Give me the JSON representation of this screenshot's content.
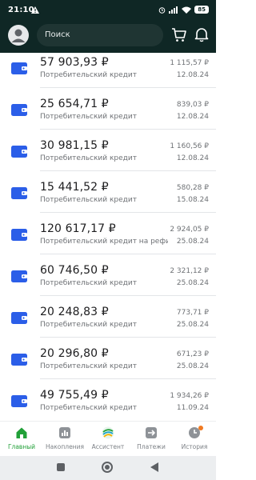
{
  "status_bar": {
    "time": "21:10",
    "battery": "85"
  },
  "header": {
    "search_placeholder": "Поиск"
  },
  "loans": [
    {
      "amount": "57 903,93 ₽",
      "description": "Потребительский кредит",
      "payment": "1 115,57 ₽",
      "date": "12.08.24"
    },
    {
      "amount": "25 654,71 ₽",
      "description": "Потребительский кредит",
      "payment": "839,03 ₽",
      "date": "12.08.24"
    },
    {
      "amount": "30 981,15 ₽",
      "description": "Потребительский кредит",
      "payment": "1 160,56 ₽",
      "date": "12.08.24"
    },
    {
      "amount": "15 441,52 ₽",
      "description": "Потребительский кредит",
      "payment": "580,28 ₽",
      "date": "15.08.24"
    },
    {
      "amount": "120 617,17 ₽",
      "description": "Потребительский кредит на рефи…",
      "payment": "2 924,05 ₽",
      "date": "25.08.24"
    },
    {
      "amount": "60 746,50 ₽",
      "description": "Потребительский кредит",
      "payment": "2 321,12 ₽",
      "date": "25.08.24"
    },
    {
      "amount": "20 248,83 ₽",
      "description": "Потребительский кредит",
      "payment": "773,71 ₽",
      "date": "25.08.24"
    },
    {
      "amount": "20 296,80 ₽",
      "description": "Потребительский кредит",
      "payment": "671,23 ₽",
      "date": "25.08.24"
    },
    {
      "amount": "49 755,49 ₽",
      "description": "Потребительский кредит",
      "payment": "1 934,26 ₽",
      "date": "11.09.24"
    }
  ],
  "tabs": [
    {
      "label": "Главный",
      "icon": "home-icon",
      "active": true
    },
    {
      "label": "Накопления",
      "icon": "chart-icon",
      "active": false
    },
    {
      "label": "Ассистент",
      "icon": "assistant-icon",
      "active": false
    },
    {
      "label": "Платежи",
      "icon": "transfer-icon",
      "active": false
    },
    {
      "label": "История",
      "icon": "history-icon",
      "active": false
    }
  ],
  "colors": {
    "header_bg": "#0f2725",
    "accent": "#21a038",
    "wallet": "#2b5ee8",
    "notification_dot": "#f07a22"
  }
}
